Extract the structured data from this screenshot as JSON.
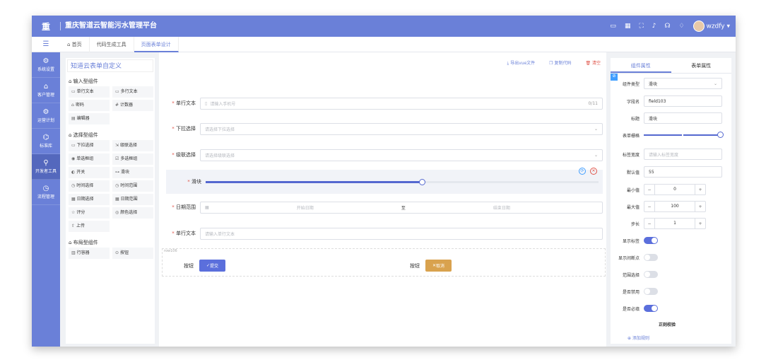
{
  "app": {
    "logo": "重",
    "title": "重庆智道云智能污水管理平台",
    "user": "wzdfy"
  },
  "topbar_icons": [
    "monitor-icon",
    "grid-icon",
    "fullscreen-icon",
    "bell-icon",
    "headset-icon",
    "shirt-icon"
  ],
  "tabs": [
    {
      "label": "首页"
    },
    {
      "label": "代码生成工具"
    },
    {
      "label": "页面表单设计"
    }
  ],
  "nav": [
    {
      "label": "系统设置",
      "icon": "⚙"
    },
    {
      "label": "客户管理",
      "icon": "⌂"
    },
    {
      "label": "运营计划",
      "icon": "⚙"
    },
    {
      "label": "标准库",
      "icon": "⌬"
    },
    {
      "label": "开发者工具",
      "icon": "⚲"
    },
    {
      "label": "流程管理",
      "icon": "◷"
    }
  ],
  "palette": {
    "title": "知道云表单自定义",
    "groups": [
      {
        "title": "输入型组件",
        "items": [
          {
            "icon": "▭",
            "label": "单行文本"
          },
          {
            "icon": "▭",
            "label": "多行文本"
          },
          {
            "icon": "⌂",
            "label": "密码"
          },
          {
            "icon": "#",
            "label": "计数器"
          },
          {
            "icon": "▤",
            "label": "编辑器"
          }
        ]
      },
      {
        "title": "选择型组件",
        "items": [
          {
            "icon": "▭",
            "label": "下拉选择"
          },
          {
            "icon": "⇲",
            "label": "级联选择"
          },
          {
            "icon": "◉",
            "label": "单选框组"
          },
          {
            "icon": "☑",
            "label": "多选框组"
          },
          {
            "icon": "◐",
            "label": "开关"
          },
          {
            "icon": "⊶",
            "label": "滑块"
          },
          {
            "icon": "◷",
            "label": "时间选择"
          },
          {
            "icon": "◷",
            "label": "时间范围"
          },
          {
            "icon": "▦",
            "label": "日期选择"
          },
          {
            "icon": "▦",
            "label": "日期范围"
          },
          {
            "icon": "☆",
            "label": "评分"
          },
          {
            "icon": "◎",
            "label": "颜色选择"
          },
          {
            "icon": "⇧",
            "label": "上传"
          }
        ]
      },
      {
        "title": "布局型组件",
        "items": [
          {
            "icon": "▥",
            "label": "行容器"
          },
          {
            "icon": "⊙",
            "label": "按钮"
          }
        ]
      }
    ]
  },
  "actions": {
    "export": "导出vue文件",
    "copy": "复制代码",
    "clear": "清空"
  },
  "form": {
    "text1": {
      "label": "单行文本",
      "placeholder": "请输入手机号",
      "count": "0/11"
    },
    "select": {
      "label": "下拉选择",
      "placeholder": "请选择下拉选择"
    },
    "cascade": {
      "label": "级联选择",
      "placeholder": "请选择级联选择"
    },
    "slider": {
      "label": "滑块",
      "value": 55,
      "max": 100
    },
    "daterange": {
      "label": "日期范围",
      "start": "开始日期",
      "sep": "至",
      "end": "结束日期"
    },
    "text2": {
      "label": "单行文本",
      "placeholder": "请输入单行文本"
    },
    "rowbox": {
      "tag": "row106"
    },
    "btn1": {
      "label": "按钮",
      "text": "提交"
    },
    "btn2": {
      "label": "按钮",
      "text": "取消"
    }
  },
  "props": {
    "tabs": [
      "组件属性",
      "表单属性"
    ],
    "type": {
      "label": "组件类型",
      "value": "滑块"
    },
    "field": {
      "label": "字段名",
      "value": "field103"
    },
    "title": {
      "label": "标题",
      "value": "滑块"
    },
    "grid": {
      "label": "表单栅格",
      "value": 24,
      "max": 24
    },
    "labelw": {
      "label": "标签宽度",
      "placeholder": "请输入标签宽度"
    },
    "default": {
      "label": "默认值",
      "value": "55"
    },
    "min": {
      "label": "最小值",
      "value": "0"
    },
    "max": {
      "label": "最大值",
      "value": "100"
    },
    "step": {
      "label": "步长",
      "value": "1"
    },
    "switches": [
      {
        "label": "显示标签",
        "on": true
      },
      {
        "label": "显示间断点",
        "on": false
      },
      {
        "label": "范围选择",
        "on": false
      },
      {
        "label": "是否禁用",
        "on": false
      },
      {
        "label": "是否必填",
        "on": true
      }
    ],
    "regex": "正则校验",
    "addrule": "添加规则"
  },
  "colors": {
    "primary": "#6a80d8",
    "danger": "#e0564b",
    "warning": "#d9a24e",
    "submit": "#5b6fdc"
  }
}
